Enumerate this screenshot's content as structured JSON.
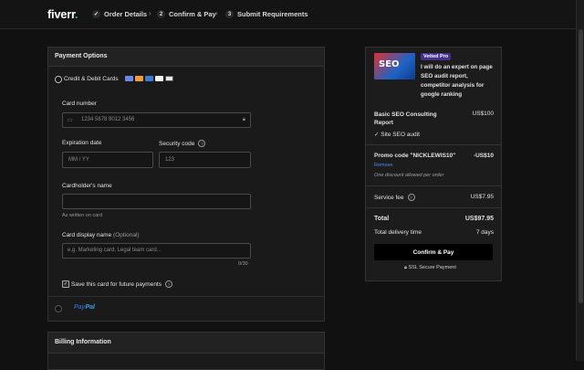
{
  "header": {
    "logo": "fiverr",
    "logo_dot": ".",
    "steps": [
      {
        "num": "✓",
        "label": "Order Details"
      },
      {
        "num": "2",
        "label": "Confirm & Pay"
      },
      {
        "num": "3",
        "label": "Submit Requirements"
      }
    ]
  },
  "payment": {
    "title": "Payment Options",
    "credit_label": "Credit & Debit Cards",
    "card_number_label": "Card number",
    "card_number_placeholder": "1234 5678 9012 3456",
    "expiration_label": "Expiration date",
    "expiration_placeholder": "MM / YY",
    "security_label": "Security code",
    "security_placeholder": "123",
    "holder_label": "Cardholder's name",
    "holder_hint": "As written on card",
    "display_label": "Card display name",
    "display_optional": "(Optional)",
    "display_placeholder": "e.g. Marketing card, Legal team card...",
    "display_counter": "0/30",
    "save_label": "Save this card for future payments",
    "paypal_pay": "Pay",
    "paypal_pal": "Pal"
  },
  "billing": {
    "title": "Billing Information"
  },
  "summary": {
    "badge": "Vetted Pro",
    "gig_title": "I will do an expert on page SEO audit report, competitor analysis for google ranking",
    "thumb_text": "SEO",
    "package_name": "Basic SEO Consulting Report",
    "package_price": "US$100",
    "feature": "Site SEO audit",
    "promo_label": "Promo code \"NICKLEWIS10\"",
    "promo_value": "-US$10",
    "remove": "Remove",
    "promo_note": "One discount allowed per order",
    "service_fee_label": "Service fee",
    "service_fee_value": "US$7.95",
    "total_label": "Total",
    "total_value": "US$97.95",
    "delivery_label": "Total delivery time",
    "delivery_value": "7 days",
    "cta": "Confirm & Pay",
    "secure": "SSL Secure Payment"
  },
  "colors": {
    "brand_green": "#1dbf73",
    "badge_purple": "#46308f",
    "link_blue": "#4d8fe8"
  }
}
